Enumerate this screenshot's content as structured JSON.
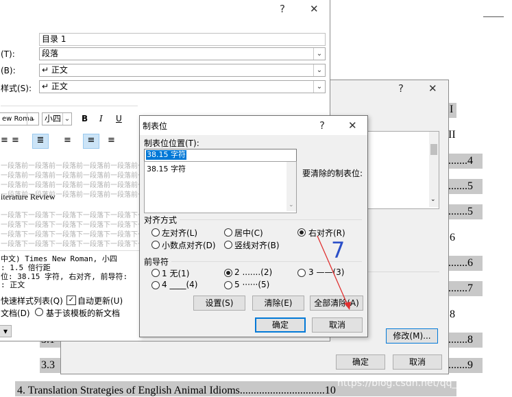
{
  "document": {
    "tail_labels": [
      "I",
      "II"
    ],
    "page_numbers": [
      ".......4",
      ".......5",
      ".......5",
      "6",
      ".......6",
      ".......7",
      "8",
      ".......8",
      ".......9"
    ],
    "toc_31": "3.1",
    "toc_33": "3.3",
    "bottom_line": "4. Translation Strategies of English Animal Idioms",
    "bottom_dots": "...............................",
    "bottom_page": "10"
  },
  "style_dialog": {
    "help": "?",
    "close": "✕",
    "name_value": "目录 1",
    "type_label": "(T):",
    "type_value": "段落",
    "based_label": "(B):",
    "based_value": "↵ 正文",
    "next_label": "样式(S):",
    "next_value": "↵ 正文",
    "font_value": "ew Roma",
    "size_value": "小四",
    "bold": "B",
    "italic": "I",
    "underline": "U",
    "prev_para": "一段落前一段落前一段落前一段落前一段落前一段落前一段落",
    "preview_text": "iterature Review",
    "next_para": "一段落下一段落下一段落下一段落下一段落下一段落下一段落",
    "desc1": "中文) Times New Roman, 小四",
    "desc2": ": 1.5 倍行距",
    "desc3": "位:  38.15 字符, 右对齐, 前导符:",
    "desc4": ": 正文",
    "add_gallery": "快速样式列表(Q)",
    "auto_update": "自动更新(U)",
    "only_doc": "文档(D)",
    "new_docs": "基于该模板的新文档"
  },
  "para_dialog": {
    "help": "?",
    "close": "✕",
    "edit_button": "修改(M)...",
    "ok": "确定",
    "cancel": "取消"
  },
  "tabs_dialog": {
    "title": "制表位",
    "help": "?",
    "close": "✕",
    "position_label": "制表位位置(T):",
    "position_value": "38.15 字符",
    "list_items": [
      "38.15 字符"
    ],
    "clear_label": "要清除的制表位:",
    "align_label": "对齐方式",
    "align_left": "左对齐(L)",
    "align_center": "居中(C)",
    "align_right": "右对齐(R)",
    "align_decimal": "小数点对齐(D)",
    "align_bar": "竖线对齐(B)",
    "leader_label": "前导符",
    "leader_1": "1 无(1)",
    "leader_2": "2 .......(2)",
    "leader_3": "3 ——(3)",
    "leader_4": "4 ____(4)",
    "leader_5": "5 ······(5)",
    "set": "设置(S)",
    "clear": "清除(E)",
    "clear_all": "全部清除(A)",
    "ok": "确定",
    "cancel": "取消"
  },
  "annotation": "7",
  "watermark": "https://blog.csdn.net/qq_40926887"
}
